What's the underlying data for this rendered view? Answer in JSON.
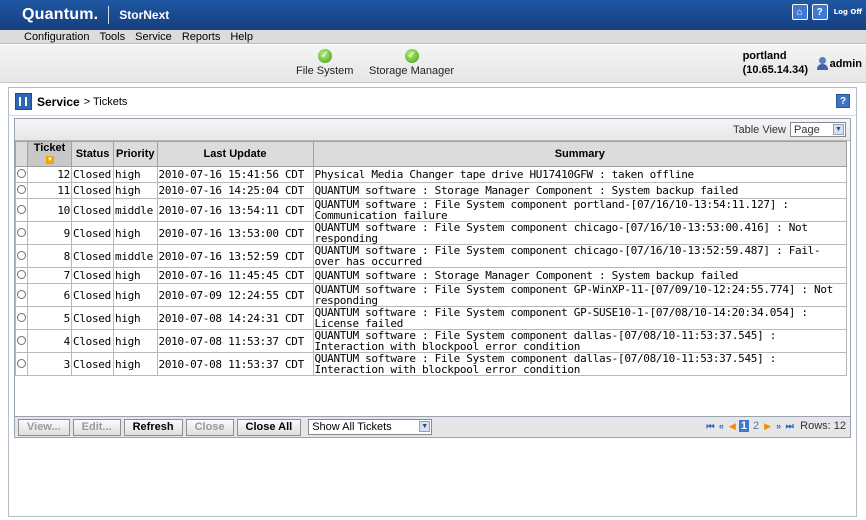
{
  "banner": {
    "brand": "Quantum.",
    "product": "StorNext",
    "logoff": "Log Off",
    "home_glyph": "⌂",
    "help_glyph": "?"
  },
  "menu": [
    "Configuration",
    "Tools",
    "Service",
    "Reports",
    "Help"
  ],
  "status": {
    "items": [
      {
        "label": "File System",
        "state": "ok"
      },
      {
        "label": "Storage Manager",
        "state": "ok"
      }
    ],
    "host_name": "portland",
    "host_ip": "(10.65.14.34)",
    "user": "admin"
  },
  "page": {
    "title": "Service",
    "crumb": "> Tickets",
    "help_glyph": "?"
  },
  "table_view": {
    "label": "Table View",
    "value": "Page"
  },
  "columns": [
    "Ticket",
    "Status",
    "Priority",
    "Last Update",
    "Summary"
  ],
  "rows": [
    {
      "ticket": "12",
      "status": "Closed",
      "priority": "high",
      "updated": "2010-07-16 15:41:56 CDT",
      "summary": "Physical Media Changer tape drive HU17410GFW : taken offline"
    },
    {
      "ticket": "11",
      "status": "Closed",
      "priority": "high",
      "updated": "2010-07-16 14:25:04 CDT",
      "summary": "QUANTUM software : Storage Manager Component : System backup failed"
    },
    {
      "ticket": "10",
      "status": "Closed",
      "priority": "middle",
      "updated": "2010-07-16 13:54:11 CDT",
      "summary": "QUANTUM software : File System component portland-[07/16/10-13:54:11.127] : Communication failure"
    },
    {
      "ticket": "9",
      "status": "Closed",
      "priority": "high",
      "updated": "2010-07-16 13:53:00 CDT",
      "summary": "QUANTUM software : File System component chicago-[07/16/10-13:53:00.416] : Not responding"
    },
    {
      "ticket": "8",
      "status": "Closed",
      "priority": "middle",
      "updated": "2010-07-16 13:52:59 CDT",
      "summary": "QUANTUM software : File System component chicago-[07/16/10-13:52:59.487] : Fail-over has occurred"
    },
    {
      "ticket": "7",
      "status": "Closed",
      "priority": "high",
      "updated": "2010-07-16 11:45:45 CDT",
      "summary": "QUANTUM software : Storage Manager Component : System backup failed"
    },
    {
      "ticket": "6",
      "status": "Closed",
      "priority": "high",
      "updated": "2010-07-09 12:24:55 CDT",
      "summary": "QUANTUM software : File System component GP-WinXP-11-[07/09/10-12:24:55.774] : Not responding"
    },
    {
      "ticket": "5",
      "status": "Closed",
      "priority": "high",
      "updated": "2010-07-08 14:24:31 CDT",
      "summary": "QUANTUM software : File System component GP-SUSE10-1-[07/08/10-14:20:34.054] : License failed"
    },
    {
      "ticket": "4",
      "status": "Closed",
      "priority": "high",
      "updated": "2010-07-08 11:53:37 CDT",
      "summary": "QUANTUM software : File System component dallas-[07/08/10-11:53:37.545] : Interaction with blockpool error condition"
    },
    {
      "ticket": "3",
      "status": "Closed",
      "priority": "high",
      "updated": "2010-07-08 11:53:37 CDT",
      "summary": "QUANTUM software : File System component dallas-[07/08/10-11:53:37.545] : Interaction with blockpool error condition"
    }
  ],
  "buttons": {
    "view": "View...",
    "edit": "Edit...",
    "refresh": "Refresh",
    "close": "Close",
    "close_all": "Close All"
  },
  "filter": {
    "value": "Show All Tickets"
  },
  "pager": {
    "pages": [
      "1",
      "2"
    ],
    "current": "1",
    "rows_label": "Rows: 12"
  },
  "colors": {
    "banner": "#1f57a3",
    "accent": "#3c78d0",
    "sort": "#f0a800"
  }
}
